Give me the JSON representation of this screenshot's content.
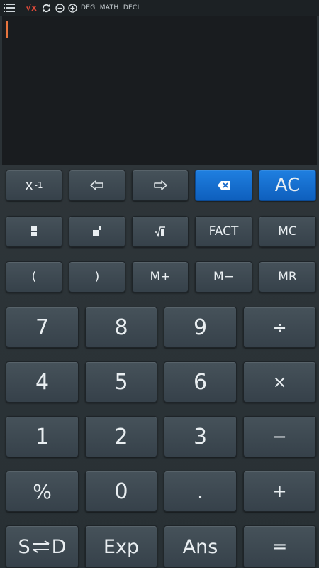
{
  "topbar": {
    "mode_text": "DEG  MATH  DECI",
    "icons": [
      "menu-icon",
      "sqrt-x-icon",
      "refresh-icon",
      "minus-circle-icon",
      "plus-circle-icon"
    ],
    "sqrt_glyph": "√x"
  },
  "display": {
    "expression": "",
    "cursor_color": "#e7743e"
  },
  "keys": {
    "inverse": {
      "base": "x",
      "sup": "-1"
    },
    "left_arrow": "left-arrow-icon",
    "right_arrow": "right-arrow-icon",
    "backspace": "backspace-icon",
    "clear": "AC",
    "fraction_1": "fraction-icon",
    "fraction_2": "mixed-fraction-icon",
    "root": "root-icon",
    "fact": "FACT",
    "mc": "MC",
    "open_paren": "(",
    "close_paren": ")",
    "m_plus": "M+",
    "m_minus": "M−",
    "mr": "MR",
    "n7": "7",
    "n8": "8",
    "n9": "9",
    "divide": "÷",
    "n4": "4",
    "n5": "5",
    "n6": "6",
    "multiply": "×",
    "n1": "1",
    "n2": "2",
    "n3": "3",
    "minus": "−",
    "percent": "%",
    "n0": "0",
    "dot": ".",
    "plus": "+",
    "sd_left": "S",
    "sd_right": "D",
    "sd_icon": "swap-arrows-icon",
    "exp": "Exp",
    "ans": "Ans",
    "equals": "="
  },
  "colors": {
    "accent_blue": "#1473d8",
    "sqrt_red": "#e04a3a",
    "background": "#2b3236",
    "display_bg": "#191c1f"
  }
}
